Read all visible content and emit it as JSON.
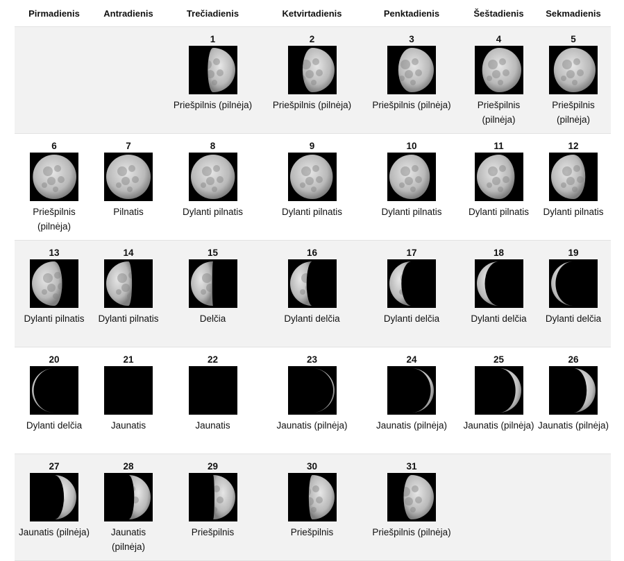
{
  "weekdays": [
    "Pirmadienis",
    "Antradienis",
    "Trečiadienis",
    "Ketvirtadienis",
    "Penktadienis",
    "Šeštadienis",
    "Sekmadienis"
  ],
  "weeks": [
    [
      null,
      null,
      {
        "day": "1",
        "phase": "Priešpilnis (pilnėja)",
        "illum": 0.62,
        "waxing": true
      },
      {
        "day": "2",
        "phase": "Priešpilnis (pilnėja)",
        "illum": 0.72,
        "waxing": true
      },
      {
        "day": "3",
        "phase": "Priešpilnis (pilnėja)",
        "illum": 0.8,
        "waxing": true
      },
      {
        "day": "4",
        "phase": "Priešpilnis (pilnėja)",
        "illum": 0.88,
        "waxing": true
      },
      {
        "day": "5",
        "phase": "Priešpilnis (pilnėja)",
        "illum": 0.94,
        "waxing": true
      }
    ],
    [
      {
        "day": "6",
        "phase": "Priešpilnis (pilnėja)",
        "illum": 0.98,
        "waxing": true
      },
      {
        "day": "7",
        "phase": "Pilnatis",
        "illum": 1.0,
        "waxing": true
      },
      {
        "day": "8",
        "phase": "Dylanti pilnatis",
        "illum": 0.99,
        "waxing": false
      },
      {
        "day": "9",
        "phase": "Dylanti pilnatis",
        "illum": 0.96,
        "waxing": false
      },
      {
        "day": "10",
        "phase": "Dylanti pilnatis",
        "illum": 0.91,
        "waxing": false
      },
      {
        "day": "11",
        "phase": "Dylanti pilnatis",
        "illum": 0.85,
        "waxing": false
      },
      {
        "day": "12",
        "phase": "Dylanti pilnatis",
        "illum": 0.77,
        "waxing": false
      }
    ],
    [
      {
        "day": "13",
        "phase": "Dylanti pilnatis",
        "illum": 0.68,
        "waxing": false
      },
      {
        "day": "14",
        "phase": "Dylanti pilnatis",
        "illum": 0.58,
        "waxing": false
      },
      {
        "day": "15",
        "phase": "Delčia",
        "illum": 0.48,
        "waxing": false
      },
      {
        "day": "16",
        "phase": "Dylanti delčia",
        "illum": 0.37,
        "waxing": false
      },
      {
        "day": "17",
        "phase": "Dylanti delčia",
        "illum": 0.27,
        "waxing": false
      },
      {
        "day": "18",
        "phase": "Dylanti delčia",
        "illum": 0.18,
        "waxing": false
      },
      {
        "day": "19",
        "phase": "Dylanti delčia",
        "illum": 0.1,
        "waxing": false
      }
    ],
    [
      {
        "day": "20",
        "phase": "Dylanti delčia",
        "illum": 0.04,
        "waxing": false
      },
      {
        "day": "21",
        "phase": "Jaunatis",
        "illum": 0.0,
        "waxing": true
      },
      {
        "day": "22",
        "phase": "Jaunatis",
        "illum": 0.0,
        "waxing": true
      },
      {
        "day": "23",
        "phase": "Jaunatis (pilnėja)",
        "illum": 0.03,
        "waxing": true
      },
      {
        "day": "24",
        "phase": "Jaunatis (pilnėja)",
        "illum": 0.07,
        "waxing": true
      },
      {
        "day": "25",
        "phase": "Jaunatis (pilnėja)",
        "illum": 0.13,
        "waxing": true
      },
      {
        "day": "26",
        "phase": "Jaunatis (pilnėja)",
        "illum": 0.2,
        "waxing": true
      }
    ],
    [
      {
        "day": "27",
        "phase": "Jaunatis (pilnėja)",
        "illum": 0.28,
        "waxing": true
      },
      {
        "day": "28",
        "phase": "Jaunatis (pilnėja)",
        "illum": 0.37,
        "waxing": true
      },
      {
        "day": "29",
        "phase": "Priešpilnis",
        "illum": 0.47,
        "waxing": true
      },
      {
        "day": "30",
        "phase": "Priešpilnis",
        "illum": 0.58,
        "waxing": true
      },
      {
        "day": "31",
        "phase": "Priešpilnis (pilnėja)",
        "illum": 0.68,
        "waxing": true
      },
      null,
      null
    ]
  ]
}
